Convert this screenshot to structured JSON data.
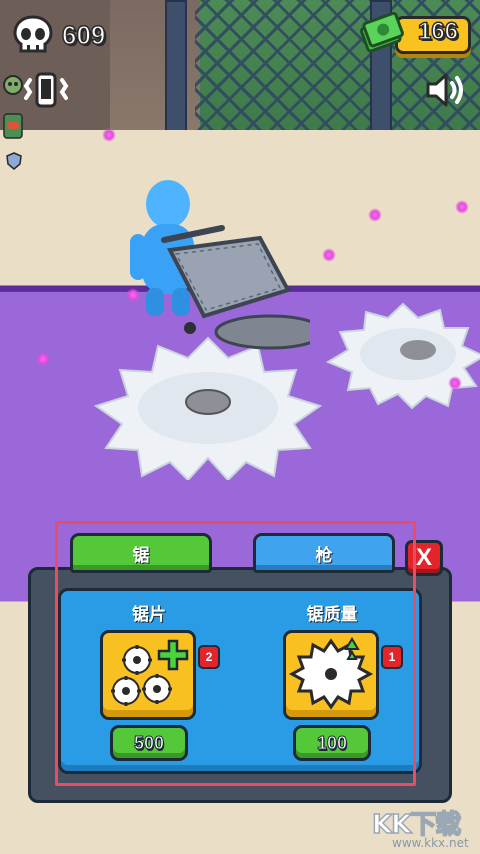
{
  "hud": {
    "kill_count": "609",
    "cash": "166",
    "icons": {
      "kills": "skull-icon",
      "cash": "cash-icon",
      "vibration": "vibrate-icon",
      "sound": "speaker-icon"
    }
  },
  "shop": {
    "tabs": [
      {
        "label": "锯",
        "active": true
      },
      {
        "label": "枪",
        "active": false
      }
    ],
    "close_label": "X",
    "items": [
      {
        "title": "锯片",
        "icon": "multi-saw-plus-icon",
        "level": "2",
        "price": "500"
      },
      {
        "title": "锯质量",
        "icon": "saw-upgrade-icon",
        "level": "1",
        "price": "100"
      }
    ]
  },
  "watermark": {
    "brand": "KK下载",
    "url": "www.kkx.net"
  },
  "colors": {
    "tab_green": "#55c83a",
    "tab_blue": "#3fa3ee",
    "close_red": "#e3242b",
    "panel_blue": "#2a9ce6",
    "icon_gold": "#f8c020",
    "highlight_frame": "#ea4c64",
    "platform_purple": "#9a68d8"
  }
}
